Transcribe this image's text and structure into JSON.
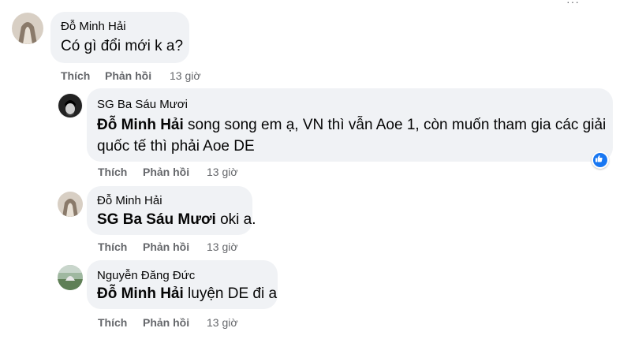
{
  "comments": [
    {
      "author": "Đỗ Minh Hải",
      "mention": "",
      "text": "Có gì đổi mới k a?",
      "actions": {
        "like": "Thích",
        "reply": "Phản hồi",
        "time": "13 giờ"
      }
    },
    {
      "author": "SG Ba Sáu Mươi",
      "mention": "Đỗ Minh Hải",
      "text_line1": " song song em ạ, VN thì vẫn Aoe 1, còn muốn tham gia các giải",
      "text_line2": "quốc tế thì phải Aoe DE",
      "actions": {
        "like": "Thích",
        "reply": "Phản hồi",
        "time": "13 giờ"
      },
      "reaction": "like-icon"
    },
    {
      "author": "Đỗ Minh Hải",
      "mention": "SG Ba Sáu Mươi",
      "text": " oki a.",
      "actions": {
        "like": "Thích",
        "reply": "Phản hồi",
        "time": "13 giờ"
      }
    },
    {
      "author": "Nguyễn Đăng Đức",
      "mention": "Đỗ Minh Hải",
      "text": " luyện DE đi a",
      "actions": {
        "like": "Thích",
        "reply": "Phản hồi",
        "time": "13 giờ"
      }
    }
  ],
  "colors": {
    "bubble": "#f0f2f5",
    "meta": "#65676b",
    "like_blue": "#1877f2"
  }
}
